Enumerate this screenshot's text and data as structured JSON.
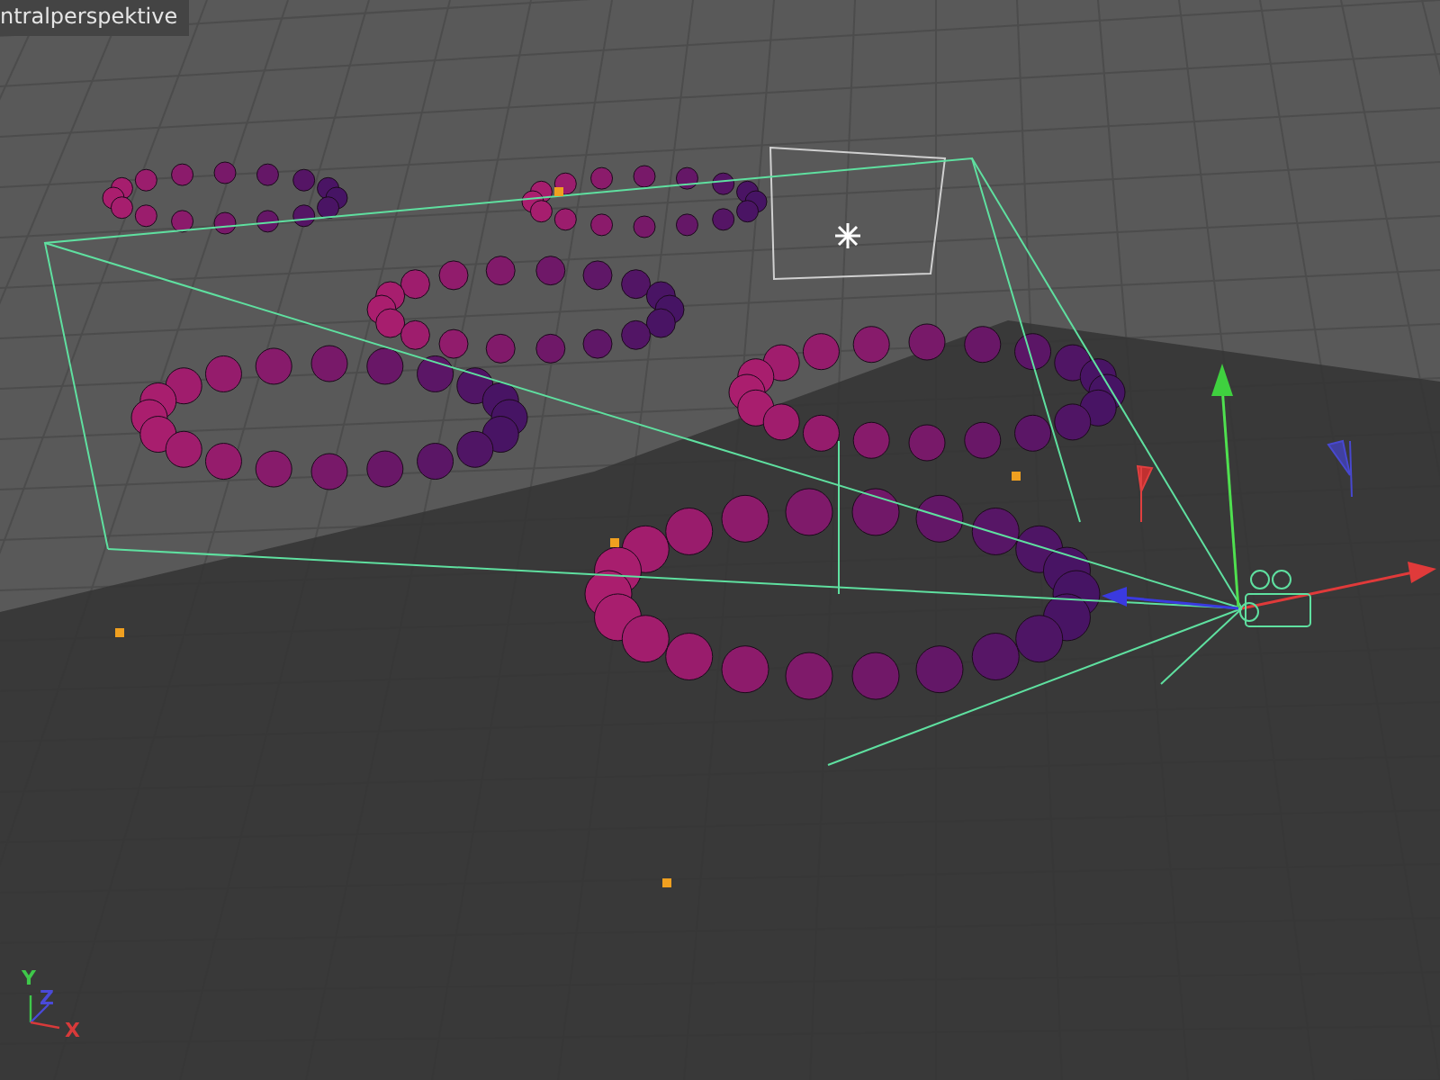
{
  "viewport": {
    "label": "ntralperspektive"
  },
  "axis_gizmo": {
    "labels": [
      {
        "text": "Y",
        "color": "#3fc84a"
      },
      {
        "text": "Z",
        "color": "#4a4ad8"
      },
      {
        "text": "X",
        "color": "#d83a3a"
      }
    ]
  }
}
